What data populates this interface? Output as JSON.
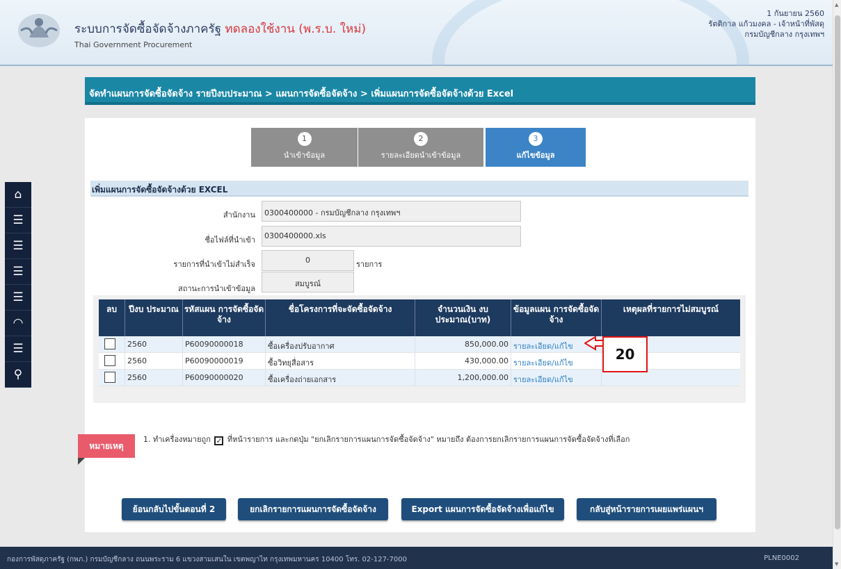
{
  "header": {
    "title": "ระบบการจัดซื้อจัดจ้างภาครัฐ",
    "trial": "ทดลองใช้งาน (พ.ร.บ. ใหม่)",
    "subtitle": "Thai Government Procurement",
    "date": "1 กันยายน 2560",
    "user": "รัตติกาล แก้วมงคล - เจ้าหน้าที่พัสดุ",
    "org": "กรมบัญชีกลาง กรุงเทพฯ"
  },
  "breadcrumb": "จัดทำแผนการจัดซื้อจัดจ้าง รายปีงบประมาณ > แผนการจัดซื้อจัดจ้าง > เพิ่มแผนการจัดซื้อจัดจ้างด้วย Excel",
  "steps": [
    {
      "num": "1",
      "label": "นำเข้าข้อมูล"
    },
    {
      "num": "2",
      "label": "รายละเอียดนำเข้าข้อมูล"
    },
    {
      "num": "3",
      "label": "แก้ไขข้อมูล"
    }
  ],
  "section_title": "เพิ่มแผนการจัดซื้อจัดจ้างด้วย EXCEL",
  "form": {
    "office_label": "สำนักงาน",
    "office_value": "0300400000 - กรมบัญชีกลาง กรุงเทพฯ",
    "file_label": "ชื่อไฟล์ที่นำเข้า",
    "file_value": "0300400000.xls",
    "failed_label": "รายการที่นำเข้าไม่สำเร็จ",
    "failed_value": "0",
    "failed_unit": "รายการ",
    "status_label": "สถานะการนำเข้าข้อมูล",
    "status_value": "สมบูรณ์"
  },
  "table": {
    "headers": {
      "delete": "ลบ",
      "year": "ปีงบ ประมาณ",
      "plan_code": "รหัสแผน การจัดซื้อจัดจ้าง",
      "project": "ชื่อโครงการที่จะจัดซื้อจัดจ้าง",
      "amount": "จำนวนเงิน งบประมาณ(บาท)",
      "plan_info": "ข้อมูลแผน การจัดซื้อจัดจ้าง",
      "reason": "เหตุผลที่รายการไม่สมบูรณ์"
    },
    "rows": [
      {
        "year": "2560",
        "code": "P60090000018",
        "project": "ซื้อเครื่องปรับอากาศ",
        "amount": "850,000.00",
        "link": "รายละเอียด/แก้ไข"
      },
      {
        "year": "2560",
        "code": "P60090000019",
        "project": "ซื้อวิทยุสื่อสาร",
        "amount": "430,000.00",
        "link": "รายละเอียด/แก้ไข"
      },
      {
        "year": "2560",
        "code": "P60090000020",
        "project": "ซื้อเครื่องถ่ายเอกสาร",
        "amount": "1,200,000.00",
        "link": "รายละเอียด/แก้ไข"
      }
    ]
  },
  "callout": "20",
  "note": {
    "tag": "หมายเหตุ",
    "text_before": "1. ทำเครื่องหมายถูก",
    "text_after": "ที่หน้ารายการ และกดปุ่ม \"ยกเลิกรายการแผนการจัดซื้อจัดจ้าง\" หมายถึง ต้องการยกเลิกรายการแผนการจัดซื้อจัดจ้างที่เลือก"
  },
  "buttons": {
    "back": "ย้อนกลับไปขั้นตอนที่ 2",
    "cancel": "ยกเลิกรายการแผนการจัดซื้อจัดจ้าง",
    "export": "Export แผนการจัดซื้อจัดจ้างเพื่อแก้ไข",
    "return": "กลับสู่หน้ารายการเผยแพร่แผนฯ"
  },
  "footer": {
    "address": "กองการพัสดุภาครัฐ (กพภ.) กรมบัญชีกลาง ถนนพระราม 6 แขวงสามเสนใน เขตพญาไท กรุงเทพมหานคร 10400 โทร. 02-127-7000",
    "code": "PLNE0002"
  },
  "colors": {
    "breadcrumb": "#1a87a5",
    "table_header": "#1d3a5f",
    "active_step": "#3c84c6",
    "button": "#1f4e7c",
    "note_tag": "#e95b6b",
    "callout_border": "#e21313"
  },
  "leftbar_icons": [
    "home-icon",
    "menu-icon",
    "menu-icon",
    "menu-icon",
    "menu-icon",
    "arc-icon",
    "menu-icon",
    "search-icon"
  ]
}
